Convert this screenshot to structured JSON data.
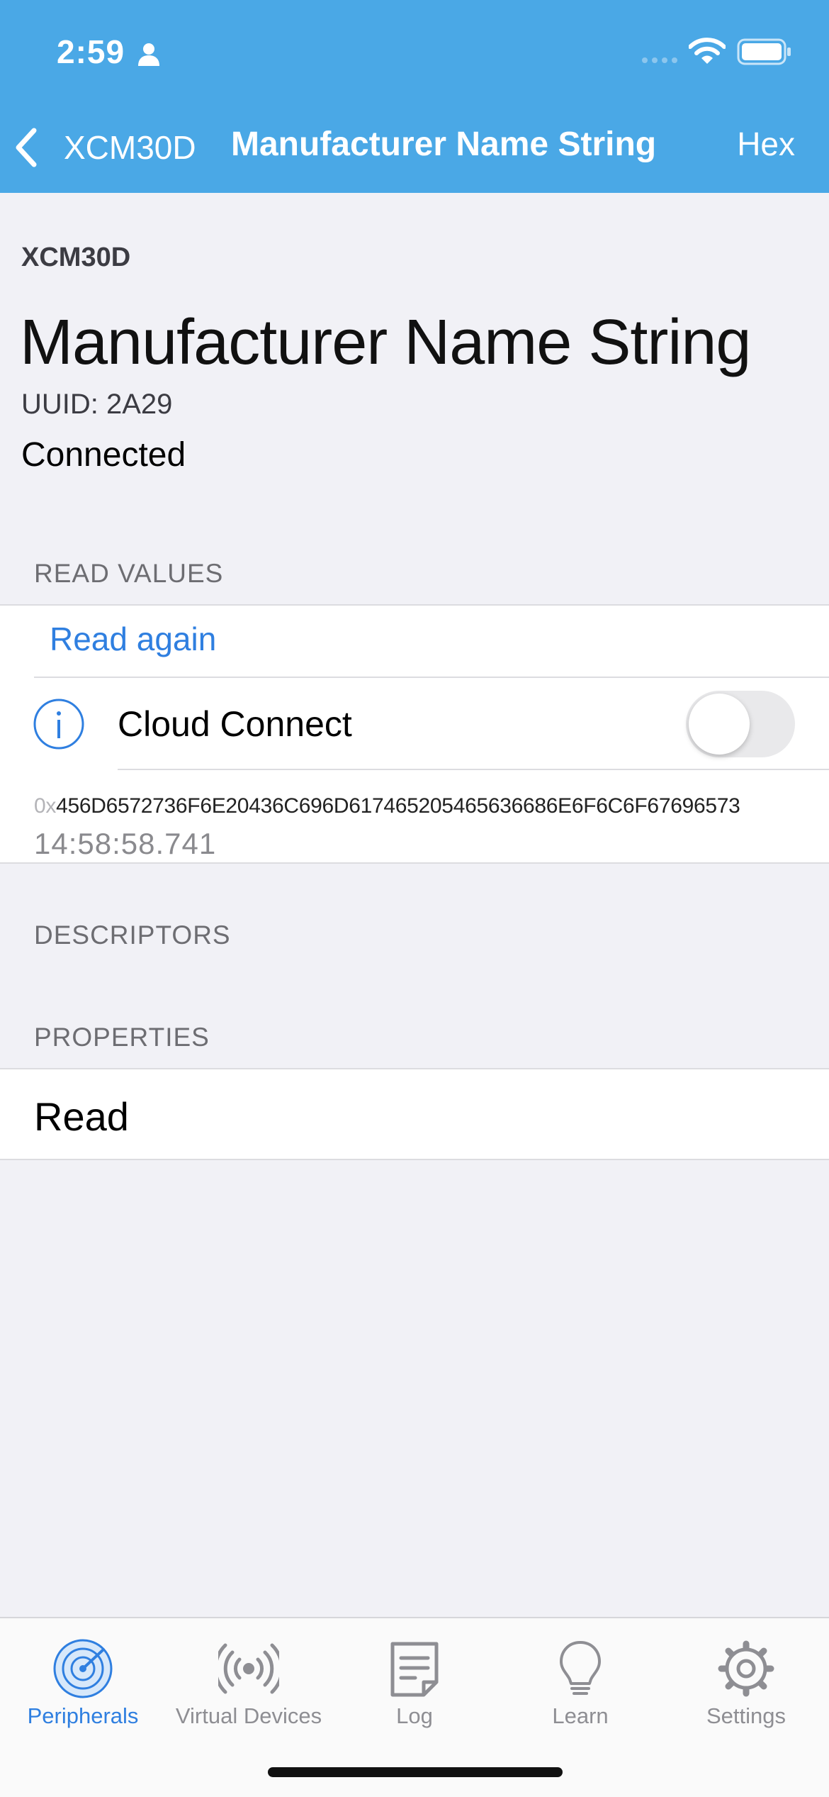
{
  "status_bar": {
    "time": "2:59"
  },
  "nav": {
    "back_label": "XCM30D",
    "title": "Manufacturer Name String",
    "hex_label": "Hex"
  },
  "header": {
    "device_name": "XCM30D",
    "characteristic_title": "Manufacturer Name String",
    "uuid": "UUID: 2A29",
    "connection_state": "Connected"
  },
  "read_values": {
    "section_title": "READ VALUES",
    "read_again_label": "Read again",
    "cloud_connect_label": "Cloud Connect",
    "cloud_connect_enabled": false,
    "value_prefix": "0x",
    "value_hex": "456D6572736F6E20436C696D617465205465636686E6F6C6F67696573",
    "timestamp": "14:58:58.741"
  },
  "descriptors": {
    "section_title": "DESCRIPTORS"
  },
  "properties": {
    "section_title": "PROPERTIES",
    "items": [
      "Read"
    ]
  },
  "tabbar": {
    "tabs": [
      {
        "label": "Peripherals",
        "icon": "radar-icon",
        "active": true
      },
      {
        "label": "Virtual Devices",
        "icon": "broadcast-icon",
        "active": false
      },
      {
        "label": "Log",
        "icon": "log-icon",
        "active": false
      },
      {
        "label": "Learn",
        "icon": "lightbulb-icon",
        "active": false
      },
      {
        "label": "Settings",
        "icon": "gear-icon",
        "active": false
      }
    ]
  },
  "colors": {
    "nav_bar": "#4aa8e6",
    "accent": "#2f7fe0",
    "background": "#f1f1f6",
    "toggle_off": "#e9e9eb"
  }
}
